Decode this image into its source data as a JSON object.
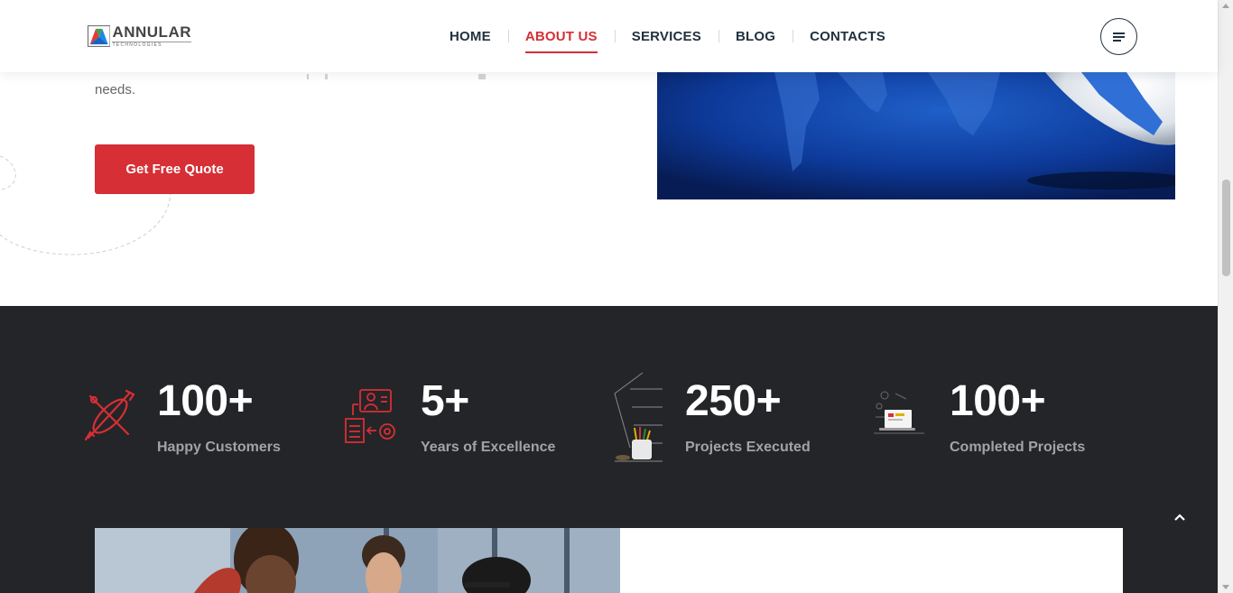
{
  "brand": {
    "name": "ANNULAR",
    "tagline": "TECHNOLOGIES"
  },
  "nav": {
    "items": [
      {
        "label": "HOME",
        "active": false
      },
      {
        "label": "ABOUT US",
        "active": true
      },
      {
        "label": "SERVICES",
        "active": false
      },
      {
        "label": "BLOG",
        "active": false
      },
      {
        "label": "CONTACTS",
        "active": false
      }
    ],
    "menu_icon": "hamburger-icon"
  },
  "intro": {
    "text_tail": "needs.",
    "cta_label": "Get Free Quote"
  },
  "stats": [
    {
      "number": "100+",
      "label": "Happy Customers",
      "icon": "design-tools-icon"
    },
    {
      "number": "5+",
      "label": "Years of Excellence",
      "icon": "workflow-icon"
    },
    {
      "number": "250+",
      "label": "Projects Executed",
      "icon": "desk-lamp-icon"
    },
    {
      "number": "100+",
      "label": "Completed Projects",
      "icon": "laptop-icon"
    }
  ],
  "colors": {
    "accent": "#d62f35",
    "nav_text": "#22313f",
    "stats_bg": "#242528",
    "stat_label": "#a2a3a5"
  },
  "scroll_top_icon": "chevron-up-icon"
}
